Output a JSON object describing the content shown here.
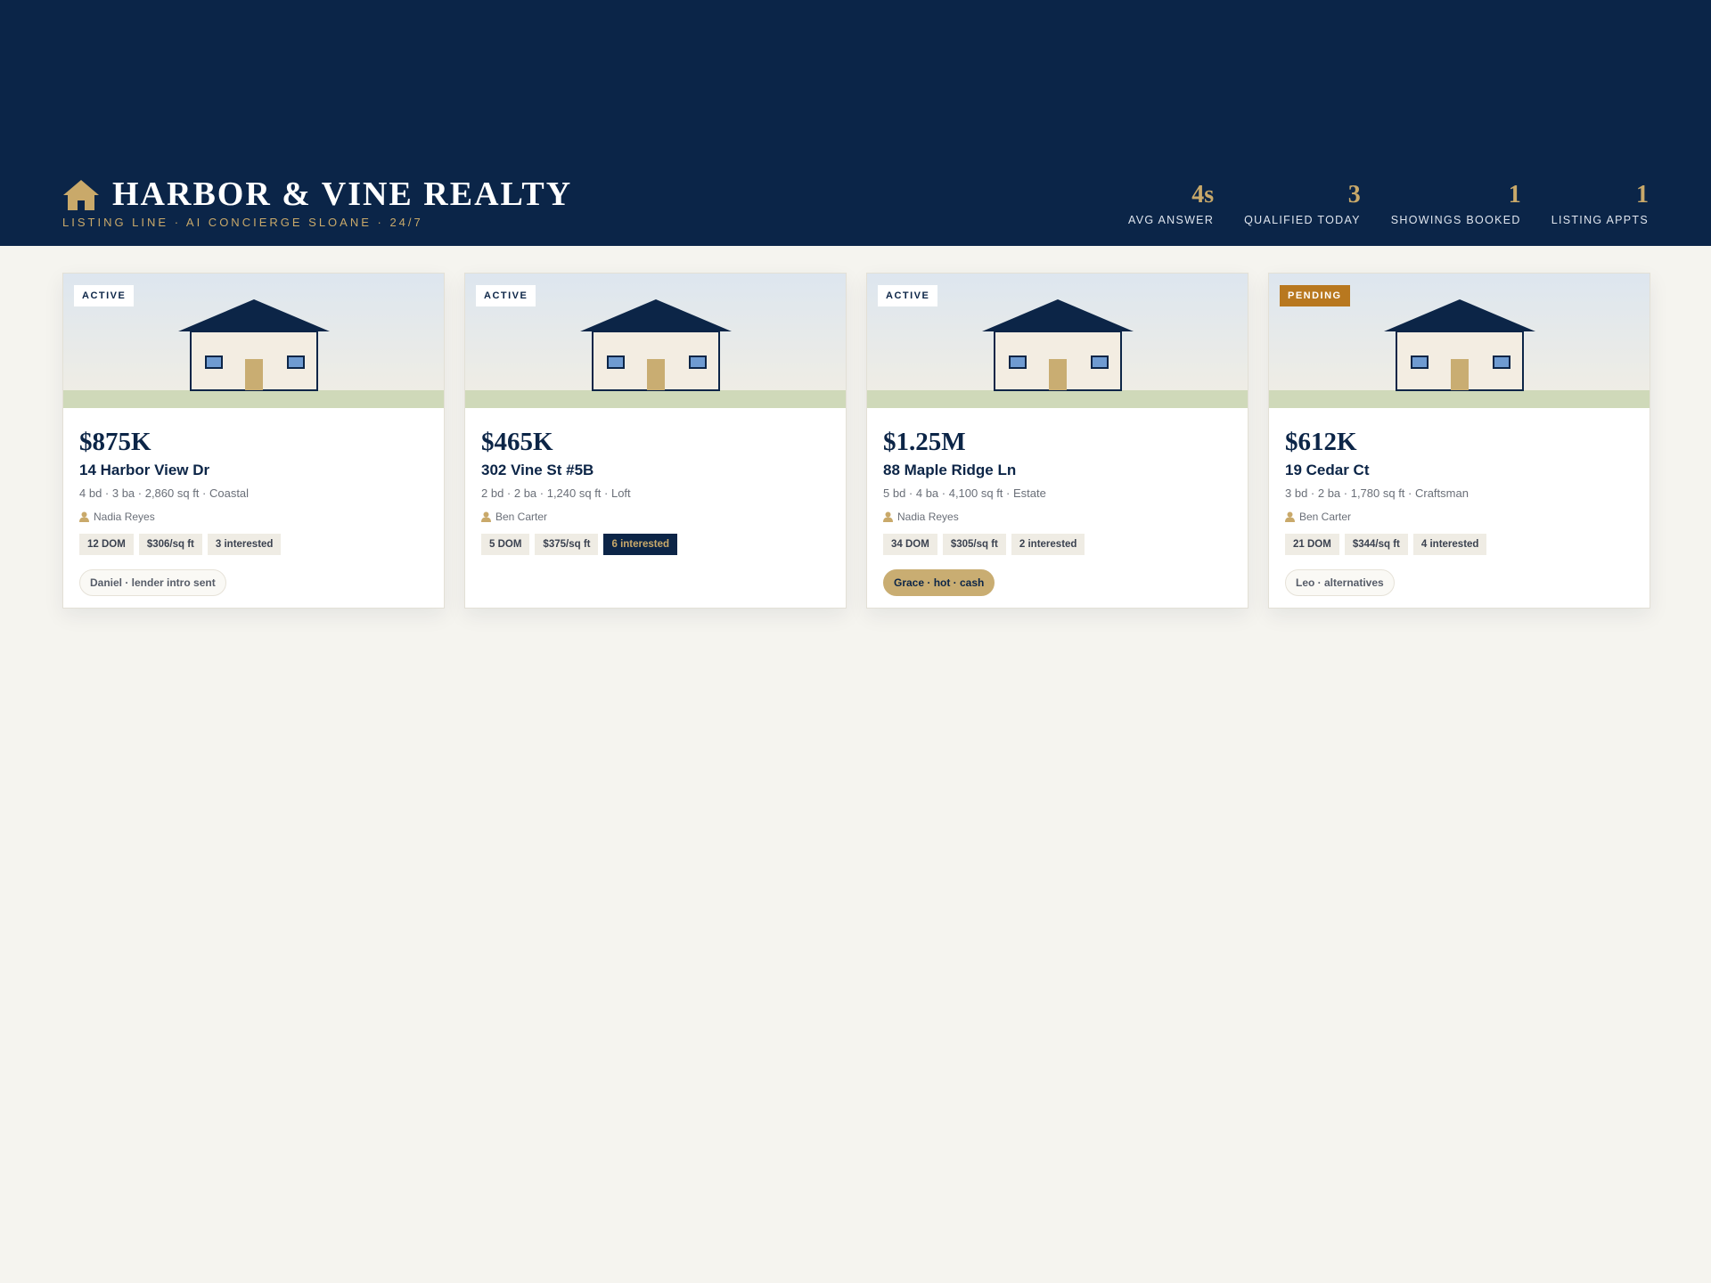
{
  "brand": {
    "title": "HARBOR & VINE REALTY",
    "subtitle": "LISTING LINE · AI CONCIERGE SLOANE · 24/7",
    "icon": "house-icon"
  },
  "stats": [
    {
      "value": "4s",
      "label": "AVG ANSWER"
    },
    {
      "value": "3",
      "label": "QUALIFIED TODAY"
    },
    {
      "value": "1",
      "label": "SHOWINGS BOOKED"
    },
    {
      "value": "1",
      "label": "LISTING APPTS"
    }
  ],
  "colors": {
    "navy": "#0b2548",
    "gold": "#c9a96a",
    "pending": "#b8781f",
    "background": "#f5f4ef"
  },
  "listings": [
    {
      "status": "ACTIVE",
      "price": "$875K",
      "address": "14 Harbor View Dr",
      "details": "4 bd · 3 ba · 2,860 sq ft · Coastal",
      "agent": "Nadia Reyes",
      "tags": [
        "12 DOM",
        "$306/sq ft",
        "3 interested"
      ],
      "lead": "Daniel · lender intro sent"
    },
    {
      "status": "ACTIVE",
      "price": "$465K",
      "address": "302 Vine St #5B",
      "details": "2 bd · 2 ba · 1,240 sq ft · Loft",
      "agent": "Ben Carter",
      "tags": [
        "5 DOM",
        "$375/sq ft",
        "6 interested"
      ],
      "lead": ""
    },
    {
      "status": "ACTIVE",
      "price": "$1.25M",
      "address": "88 Maple Ridge Ln",
      "details": "5 bd · 4 ba · 4,100 sq ft · Estate",
      "agent": "Nadia Reyes",
      "tags": [
        "34 DOM",
        "$305/sq ft",
        "2 interested"
      ],
      "lead": "Grace · hot · cash"
    },
    {
      "status": "PENDING",
      "price": "$612K",
      "address": "19 Cedar Ct",
      "details": "3 bd · 2 ba · 1,780 sq ft · Craftsman",
      "agent": "Ben Carter",
      "tags": [
        "21 DOM",
        "$344/sq ft",
        "4 interested"
      ],
      "lead": "Leo · alternatives"
    }
  ]
}
